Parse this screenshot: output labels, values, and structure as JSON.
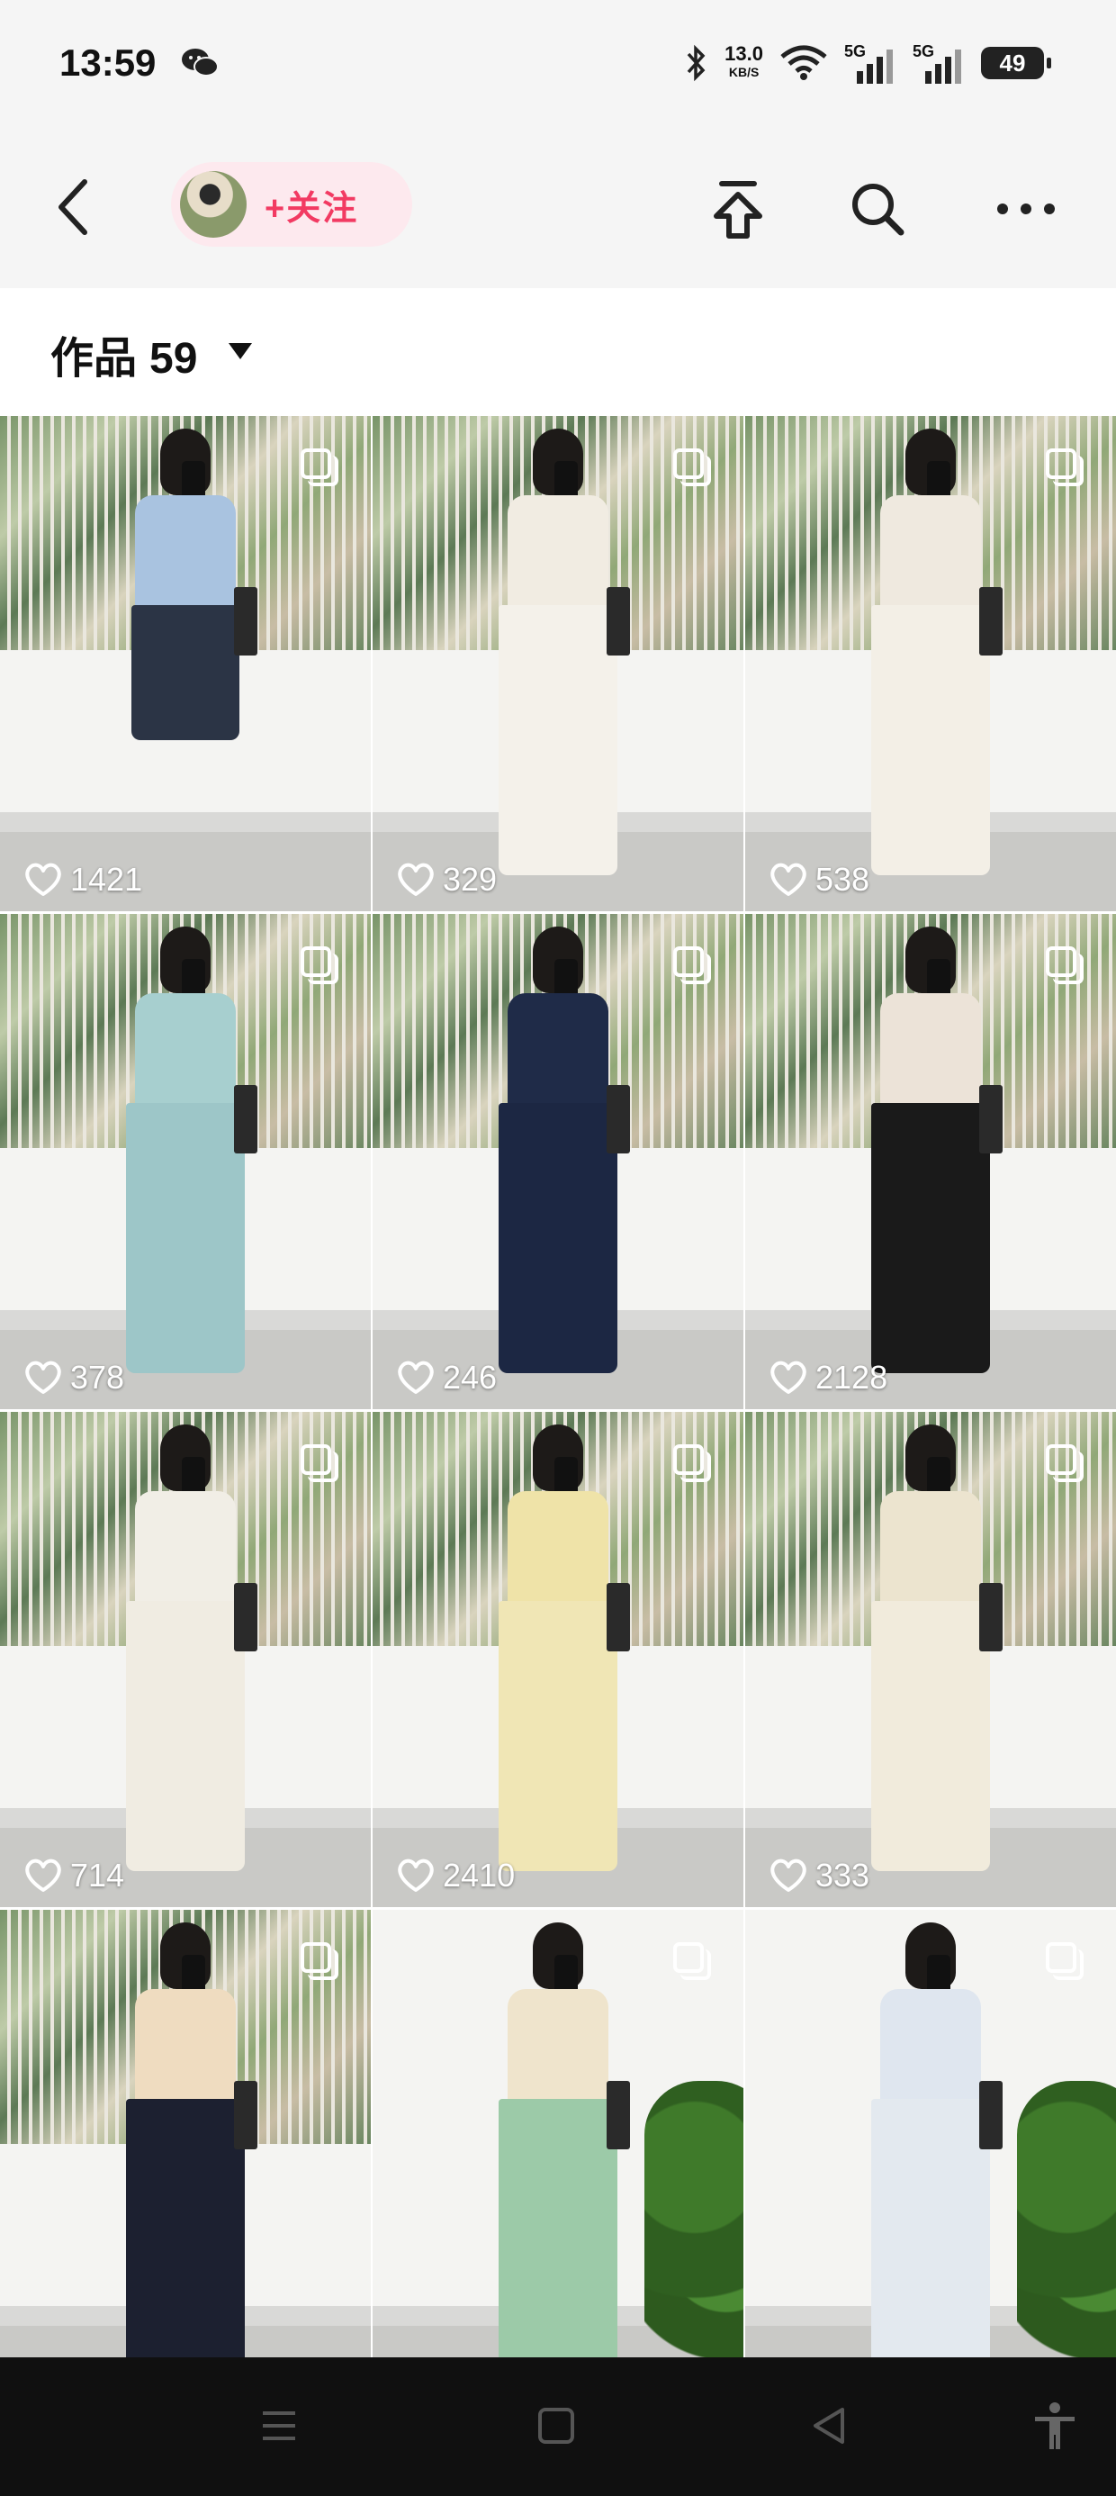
{
  "status_bar": {
    "time": "13:59",
    "net_speed_value": "13.0",
    "net_speed_unit": "KB/S",
    "signal_1_label": "5G",
    "signal_2_label": "5G",
    "battery_level": "49",
    "icons": [
      "wechat-icon",
      "bluetooth-icon",
      "wifi-icon",
      "signal-icon",
      "battery-icon"
    ]
  },
  "header": {
    "follow_label": "+关注",
    "icons": [
      "back-arrow-icon",
      "share-upload-icon",
      "search-icon",
      "more-icon"
    ]
  },
  "works": {
    "title": "作品",
    "count": "59",
    "caret_icon": "caret-down-icon"
  },
  "colors": {
    "accent_follow": "#f23a62",
    "follow_chip_bg": "#fde9ee",
    "nav_bg": "#101010"
  },
  "posts": [
    {
      "likes": "1421",
      "top": "#a9c3e0",
      "bottom": "#2b3445",
      "bottom_style": "short",
      "multi": true
    },
    {
      "likes": "329",
      "top": "#f1ece2",
      "bottom": "#f4f1ea",
      "bottom_style": "long",
      "multi": true
    },
    {
      "likes": "538",
      "top": "#efe9df",
      "bottom": "#f3efe6",
      "bottom_style": "long",
      "multi": true
    },
    {
      "likes": "378",
      "top": "#a7cfcf",
      "bottom": "#9dc6c8",
      "bottom_style": "long",
      "multi": true
    },
    {
      "likes": "246",
      "top": "#1f2b48",
      "bottom": "#1c2743",
      "bottom_style": "long",
      "multi": true
    },
    {
      "likes": "2128",
      "top": "#ece3d8",
      "bottom": "#1a1a1a",
      "bottom_style": "long",
      "multi": true
    },
    {
      "likes": "714",
      "top": "#f1eee6",
      "bottom": "#f0ece2",
      "bottom_style": "long",
      "multi": true
    },
    {
      "likes": "2410",
      "top": "#efe3a8",
      "bottom": "#f0e6b5",
      "bottom_style": "long",
      "multi": true
    },
    {
      "likes": "333",
      "top": "#ece4cf",
      "bottom": "#f1ebdc",
      "bottom_style": "long",
      "multi": true
    },
    {
      "likes": "",
      "top": "#efdcc0",
      "bottom": "#1c2030",
      "bottom_style": "long",
      "multi": true
    },
    {
      "likes": "",
      "top": "#efe4cc",
      "bottom": "#9ccaa8",
      "bottom_style": "long",
      "multi": true
    },
    {
      "likes": "",
      "top": "#dfe6ef",
      "bottom": "#e3e9ef",
      "bottom_style": "long",
      "multi": true
    }
  ],
  "nav_bar": {
    "icons": [
      "menu-icon",
      "home-square-icon",
      "back-triangle-icon",
      "accessibility-icon"
    ]
  }
}
